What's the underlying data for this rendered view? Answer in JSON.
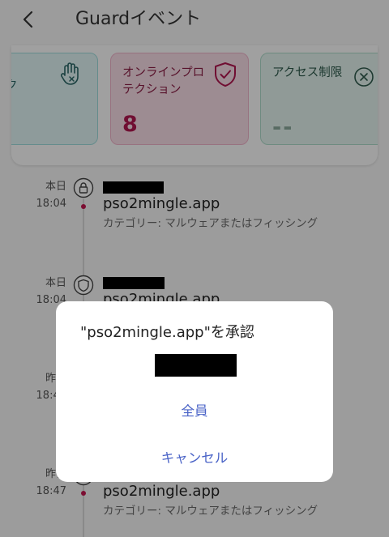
{
  "header": {
    "title": "Guardイベント"
  },
  "cards": [
    {
      "label": "ク"
    },
    {
      "label": "オンラインプロテクション",
      "value": "8"
    },
    {
      "label": "アクセス制限",
      "value": "--"
    }
  ],
  "events": [
    {
      "date": "本日",
      "time": "18:04",
      "domain": "pso2mingle.app",
      "category": "カテゴリー: マルウェアまたはフィッシング",
      "icon": "lock-icon"
    },
    {
      "date": "本日",
      "time": "18:04",
      "domain": "pso2mingle.app",
      "icon": "shield-icon"
    },
    {
      "date": "昨日",
      "time": "18:47"
    },
    {
      "date": "昨日",
      "time": "18:47",
      "domain": "pso2mingle.app",
      "category": "カテゴリー: マルウェアまたはフィッシング"
    }
  ],
  "dialog": {
    "title": "\"pso2mingle.app\"を承認",
    "all_label": "全員",
    "cancel_label": "キャンセル"
  },
  "colors": {
    "accent": "#c3174f",
    "link": "#4a63c7"
  }
}
